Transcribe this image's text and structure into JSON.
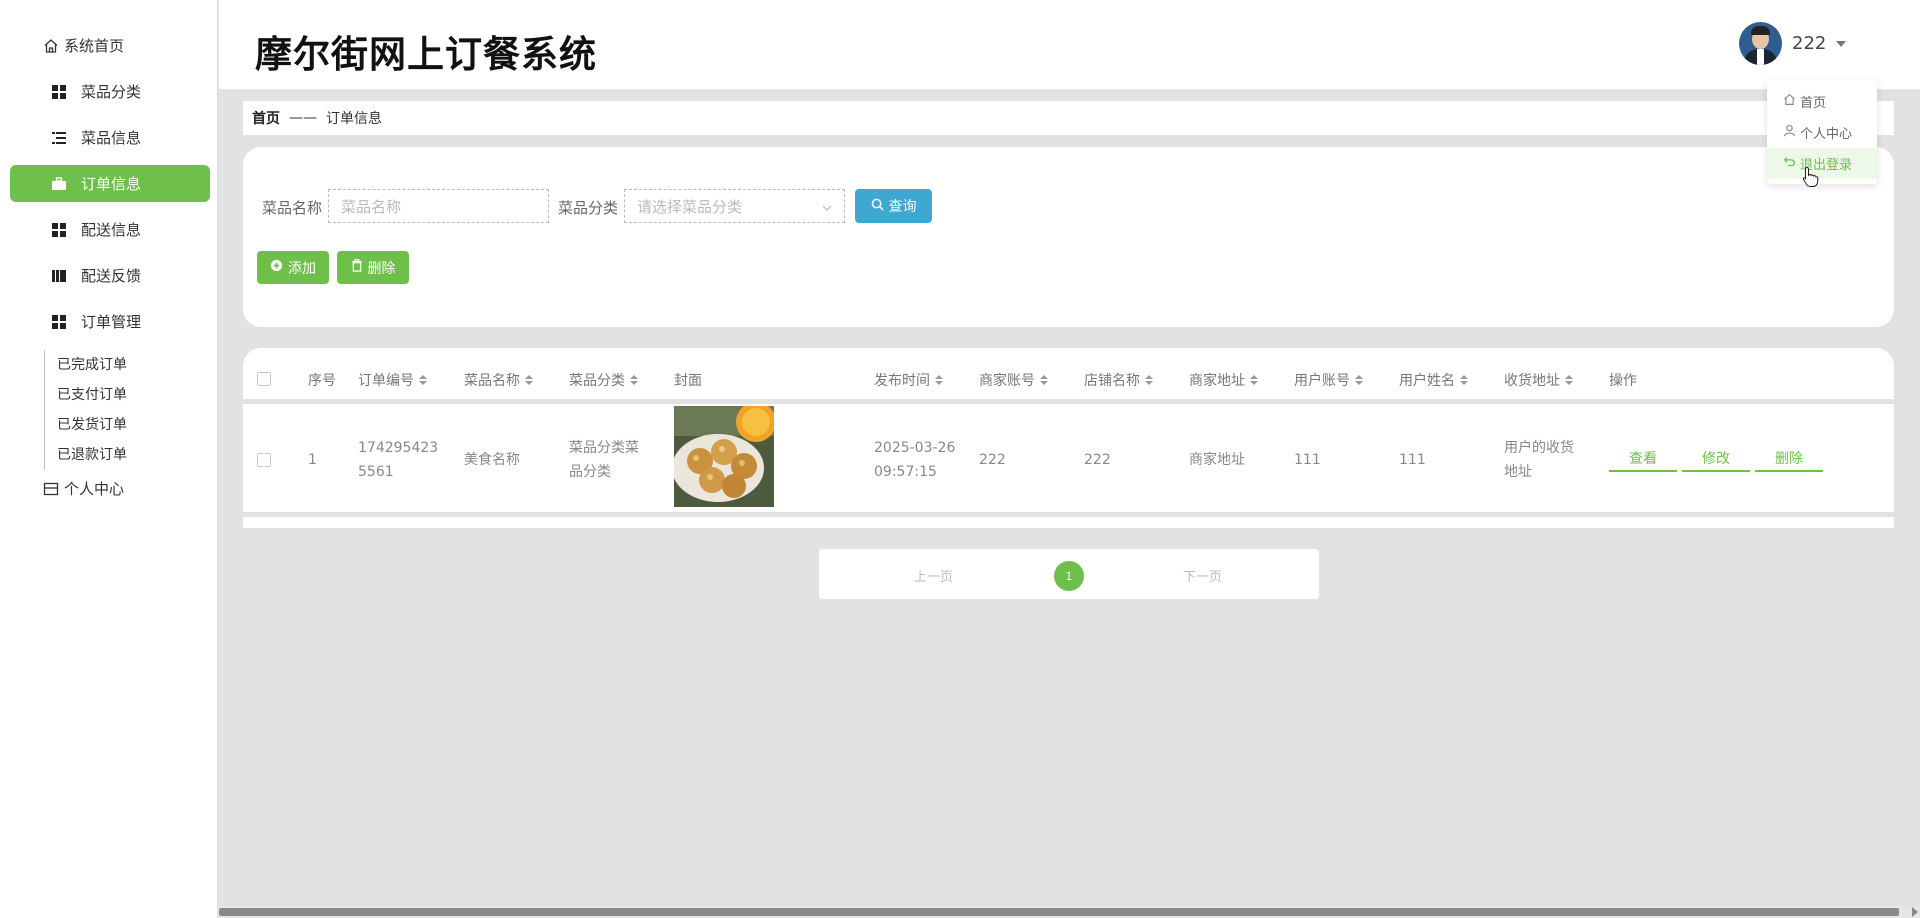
{
  "app": {
    "title": "摩尔街网上订餐系统",
    "username": "222"
  },
  "sidebar": {
    "home_label": "系统首页",
    "items": [
      {
        "label": "菜品分类",
        "icon": "grid-icon"
      },
      {
        "label": "菜品信息",
        "icon": "list-icon"
      },
      {
        "label": "订单信息",
        "icon": "briefcase-icon",
        "active": true
      },
      {
        "label": "配送信息",
        "icon": "grid-icon"
      },
      {
        "label": "配送反馈",
        "icon": "books-icon"
      },
      {
        "label": "订单管理",
        "icon": "grid-icon"
      }
    ],
    "sub_items": [
      "已完成订单",
      "已支付订单",
      "已发货订单",
      "已退款订单"
    ],
    "personal_label": "个人中心"
  },
  "user_menu": {
    "items": [
      "首页",
      "个人中心",
      "退出登录"
    ]
  },
  "breadcrumb": {
    "home": "首页",
    "separator": "——",
    "current": "订单信息"
  },
  "search": {
    "dish_name_label": "菜品名称",
    "dish_name_placeholder": "菜品名称",
    "category_label": "菜品分类",
    "category_placeholder": "请选择菜品分类",
    "query_button": "查询",
    "add_button": "添加",
    "delete_button": "删除"
  },
  "table": {
    "headers": {
      "index": "序号",
      "order_no": "订单编号",
      "dish_name": "菜品名称",
      "category": "菜品分类",
      "cover": "封面",
      "publish_time": "发布时间",
      "merchant_account": "商家账号",
      "shop_name": "店铺名称",
      "merchant_address": "商家地址",
      "user_account": "用户账号",
      "user_name": "用户姓名",
      "delivery_address": "收货地址",
      "actions": "操作"
    },
    "rows": [
      {
        "index": "1",
        "order_no_l1": "174295423",
        "order_no_l2": "5561",
        "dish_name": "美食名称",
        "category_l1": "菜品分类菜",
        "category_l2": "品分类",
        "publish_date": "2025-03-26",
        "publish_clock": "09:57:15",
        "merchant_account": "222",
        "shop_name": "222",
        "merchant_address": "商家地址",
        "user_account": "111",
        "user_name": "111",
        "address_l1": "用户的收货",
        "address_l2": "地址",
        "view": "查看",
        "edit": "修改",
        "delete": "删除"
      }
    ]
  },
  "pagination": {
    "prev": "上一页",
    "current": "1",
    "next": "下一页"
  },
  "colors": {
    "accent_green": "#6fc04a",
    "query_blue": "#3fa8d2"
  }
}
